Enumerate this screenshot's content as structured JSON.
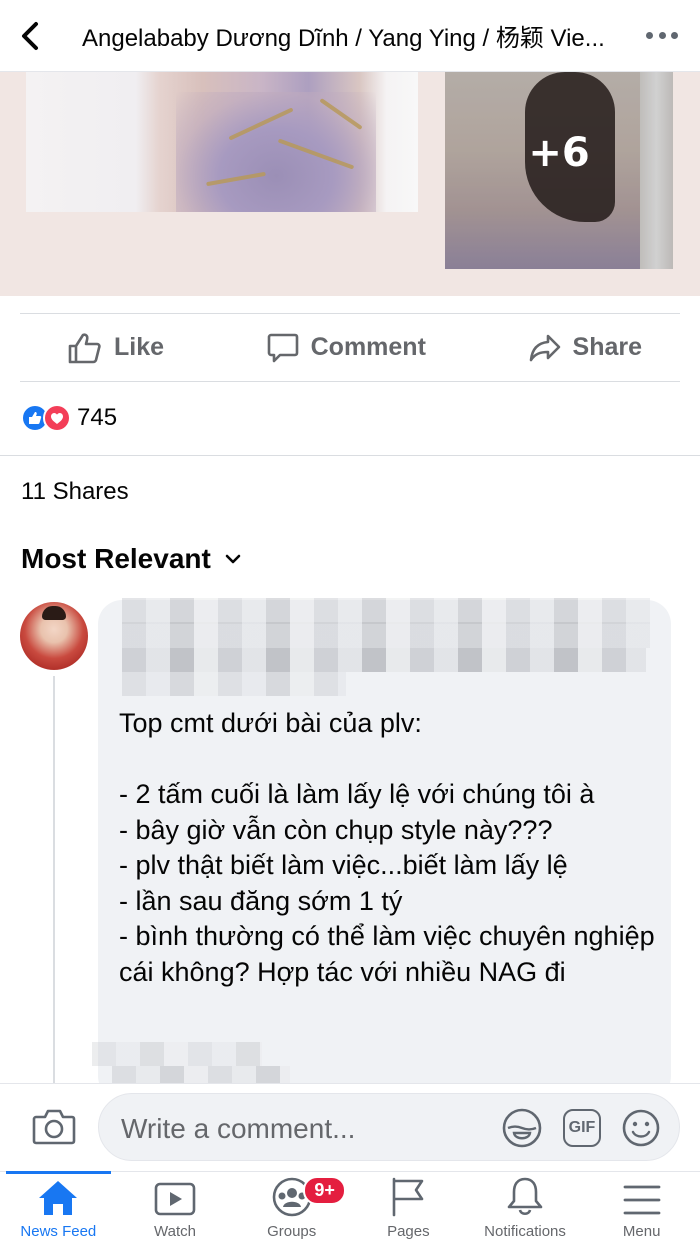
{
  "header": {
    "title": "Angelababy Dương Dĩnh / Yang Ying / 杨颖 Vie..."
  },
  "photos": {
    "more_count": "+6"
  },
  "actions": {
    "like": "Like",
    "comment": "Comment",
    "share": "Share"
  },
  "reactions": {
    "count": "745"
  },
  "shares": "11 Shares",
  "sort": {
    "label": "Most Relevant"
  },
  "comment": {
    "text": "Top cmt dưới bài của plv:\n\n- 2 tấm cuối là làm lấy lệ với chúng tôi à\n- bây giờ vẫn còn chụp style này???\n- plv thật biết làm việc...biết làm lấy lệ\n- lần sau đăng sớm 1 tý\n- bình thường có thể làm việc chuyên nghiệp cái không? Hợp tác với nhiều NAG đi"
  },
  "composer": {
    "placeholder": "Write a comment..."
  },
  "nav": {
    "items": [
      {
        "label": "News Feed",
        "icon": "home-icon",
        "active": true
      },
      {
        "label": "Watch",
        "icon": "watch-icon"
      },
      {
        "label": "Groups",
        "icon": "groups-icon",
        "badge": "9+"
      },
      {
        "label": "Pages",
        "icon": "flag-icon"
      },
      {
        "label": "Notifications",
        "icon": "bell-icon"
      },
      {
        "label": "Menu",
        "icon": "menu-icon"
      }
    ]
  },
  "colors": {
    "accent": "#1877f2",
    "badge": "#e41e3f",
    "love": "#f33e58",
    "secondary_text": "#65676b",
    "bubble": "#f0f2f5"
  }
}
